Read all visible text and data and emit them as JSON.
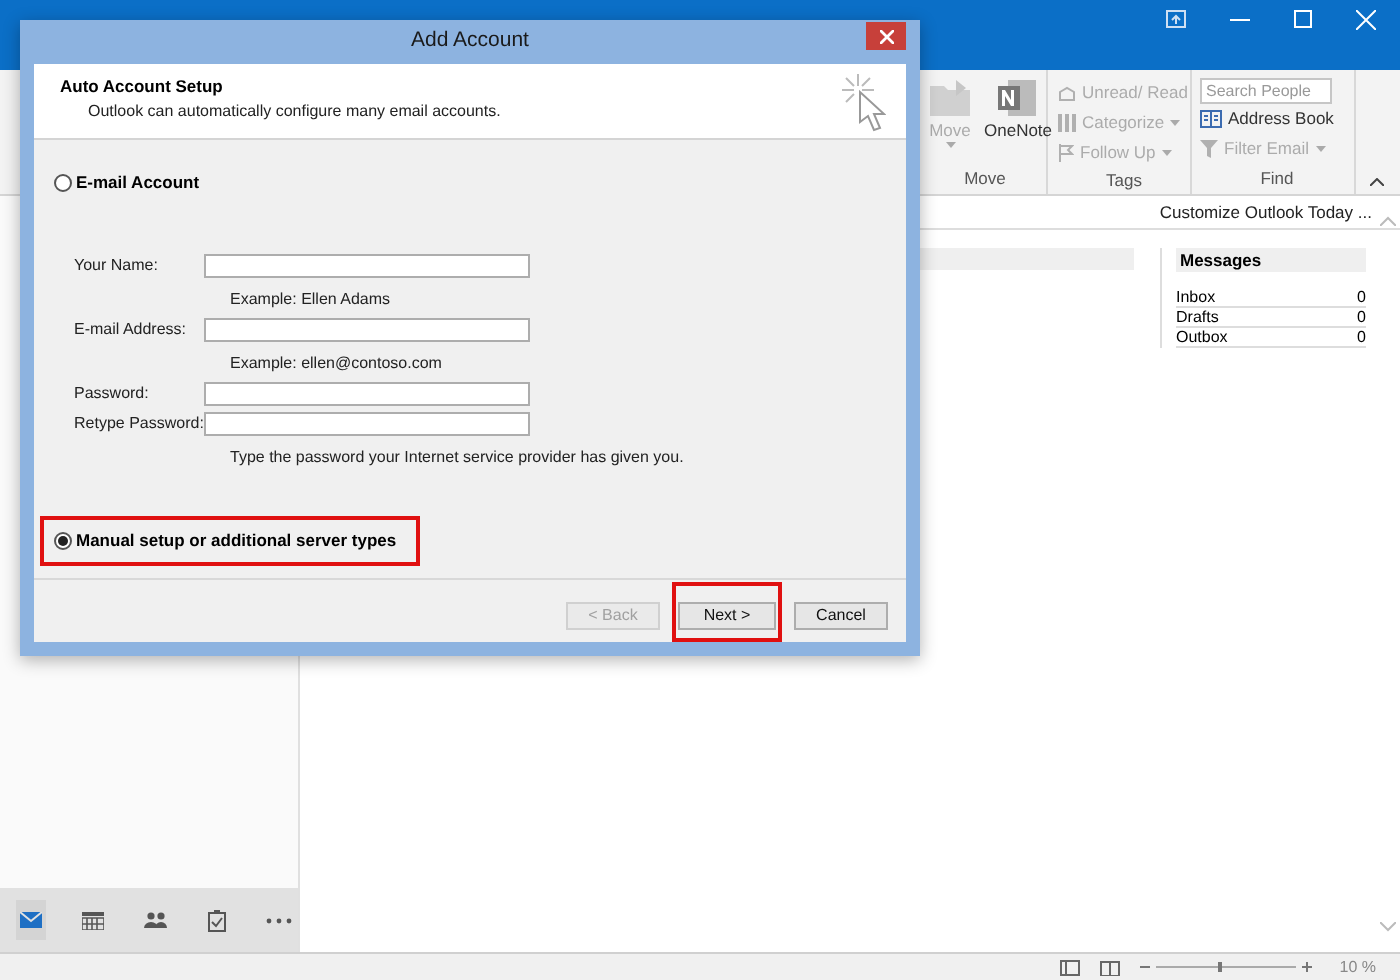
{
  "ribbon": {
    "groups": [
      {
        "label": "Move",
        "items": [
          {
            "label": "Move",
            "kind": "large",
            "disabled": true,
            "dropdown": true
          },
          {
            "label": "OneNote",
            "kind": "large",
            "disabled": false,
            "dropdown": false
          }
        ]
      },
      {
        "label": "Tags",
        "items": [
          {
            "label": "Unread/ Read",
            "kind": "small",
            "disabled": true,
            "dropdown": false
          },
          {
            "label": "Categorize",
            "kind": "small",
            "disabled": true,
            "dropdown": true
          },
          {
            "label": "Follow Up",
            "kind": "small",
            "disabled": true,
            "dropdown": true
          }
        ]
      },
      {
        "label": "Find",
        "items": [
          {
            "placeholder": "Search People",
            "kind": "search"
          },
          {
            "label": "Address Book",
            "kind": "small",
            "disabled": false,
            "dropdown": false
          },
          {
            "label": "Filter Email",
            "kind": "small",
            "disabled": true,
            "dropdown": true
          }
        ]
      }
    ]
  },
  "outlook_today": {
    "customize_link": "Customize Outlook Today ...",
    "messages": {
      "title": "Messages",
      "rows": [
        {
          "name": "Inbox",
          "count": "0"
        },
        {
          "name": "Drafts",
          "count": "0"
        },
        {
          "name": "Outbox",
          "count": "0"
        }
      ]
    }
  },
  "nav": [
    {
      "kind": "mail",
      "selected": true
    },
    {
      "kind": "calendar",
      "selected": false
    },
    {
      "kind": "people",
      "selected": false
    },
    {
      "kind": "tasks",
      "selected": false
    },
    {
      "kind": "more",
      "selected": false
    }
  ],
  "status_bar": {
    "zoom_slider": {
      "level": 0.45
    },
    "zoom": "10 %"
  },
  "dialog": {
    "title": "Add Account",
    "header": {
      "title": "Auto Account Setup",
      "subtitle": "Outlook can automatically configure many email accounts."
    },
    "options": [
      {
        "label": "E-mail Account",
        "selected": false,
        "highlighted": false
      },
      {
        "label": "Manual setup or additional server types",
        "selected": true,
        "highlighted": true
      }
    ],
    "fields": [
      {
        "label": "Your Name:",
        "hint": "Example: Ellen Adams"
      },
      {
        "label": "E-mail Address:",
        "hint": "Example: ellen@contoso.com"
      },
      {
        "label": "Password:"
      },
      {
        "label": "Retype Password:",
        "hint": "Type the password your Internet service provider has given you."
      }
    ],
    "buttons": [
      {
        "label": "< Back",
        "disabled": true,
        "highlighted": false
      },
      {
        "label": "Next >",
        "disabled": false,
        "highlighted": true
      },
      {
        "label": "Cancel",
        "disabled": false,
        "highlighted": false
      }
    ]
  }
}
